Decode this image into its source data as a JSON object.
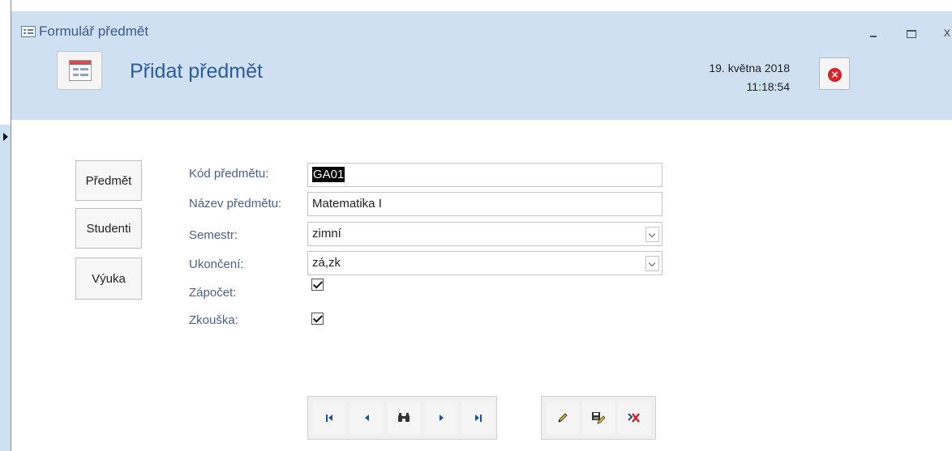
{
  "window": {
    "title": "Formulář předmět",
    "minimize_icon": "minimize-icon",
    "maximize_icon": "maximize-icon",
    "close_label": "x"
  },
  "header": {
    "title": "Přidat předmět",
    "date": "19. května 2018",
    "time": "11:18:54",
    "icon": "form-icon",
    "close_icon": "close-circle-icon"
  },
  "side_nav": [
    {
      "label": "Předmět"
    },
    {
      "label": "Studenti"
    },
    {
      "label": "Výuka"
    }
  ],
  "form": {
    "code_label": "Kód předmětu:",
    "code_value": "GA01",
    "name_label": "Název předmětu:",
    "name_value": "Matematika I",
    "semester_label": "Semestr:",
    "semester_value": "zimní",
    "completion_label": "Ukončení:",
    "completion_value": "zá,zk",
    "credit_label": "Zápočet:",
    "credit_checked": true,
    "exam_label": "Zkouška:",
    "exam_checked": true
  },
  "record_nav": {
    "first_icon": "first-record-icon",
    "prev_icon": "previous-record-icon",
    "find_icon": "binoculars-icon",
    "next_icon": "next-record-icon",
    "last_icon": "last-record-icon"
  },
  "record_actions": {
    "edit_icon": "pencil-icon",
    "save_icon": "save-icon",
    "delete_icon": "delete-record-icon"
  },
  "colors": {
    "header_bg": "#cfe0f3",
    "title_color": "#2f5a9a",
    "label_color": "#4a5f8a",
    "nav_icon_color": "#1a4fa0",
    "delete_color": "#d02020"
  }
}
